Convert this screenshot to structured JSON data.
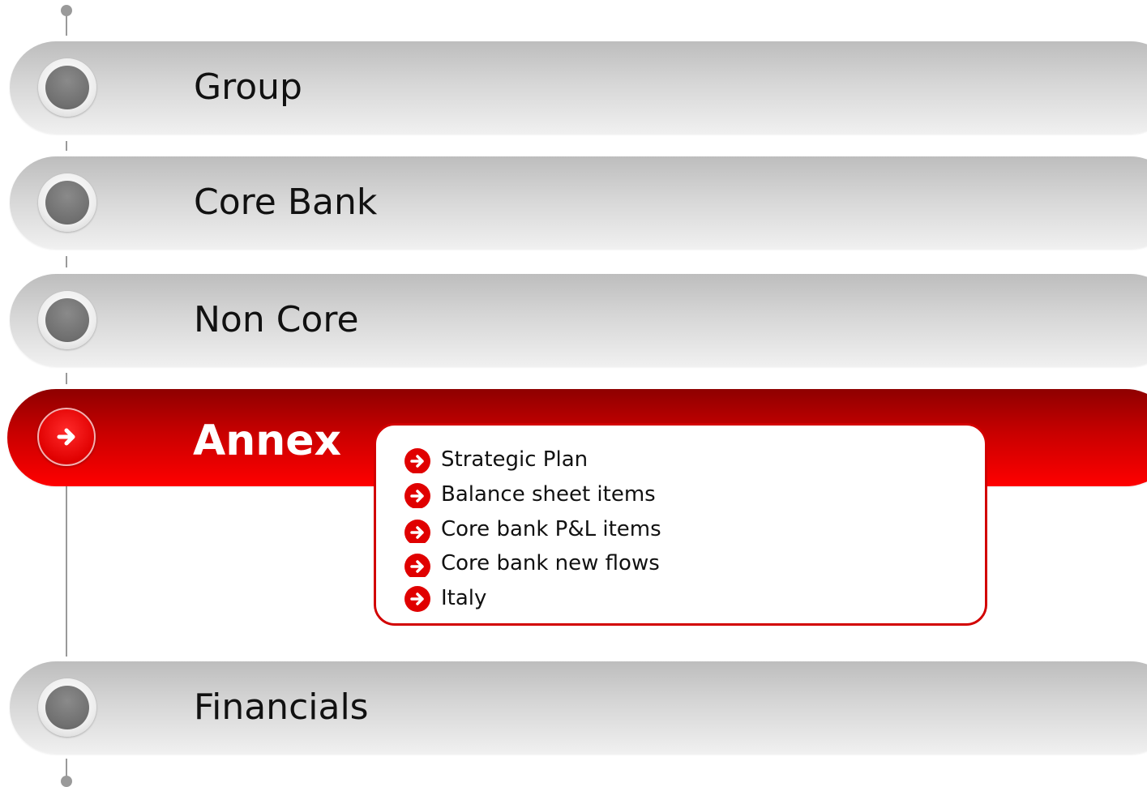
{
  "nav": {
    "items": [
      {
        "label": "Group",
        "active": false
      },
      {
        "label": "Core Bank",
        "active": false
      },
      {
        "label": "Non Core",
        "active": false
      },
      {
        "label": "Annex",
        "active": true
      },
      {
        "label": "Financials",
        "active": false
      }
    ]
  },
  "submenu": {
    "items": [
      {
        "label": "Strategic Plan",
        "icon": "arrow-right-circle-icon"
      },
      {
        "label": "Balance sheet items",
        "icon": "arrow-right-circle-icon"
      },
      {
        "label": "Core bank P&L items",
        "icon": "arrow-right-circle-icon"
      },
      {
        "label": "Core bank new flows",
        "icon": "arrow-right-circle-icon"
      },
      {
        "label": "Italy",
        "icon": "arrow-right-circle-icon"
      }
    ]
  },
  "colors": {
    "accent": "#e00000",
    "inactive_pill": "#d6d6d6",
    "timeline": "#9a9a9a"
  }
}
